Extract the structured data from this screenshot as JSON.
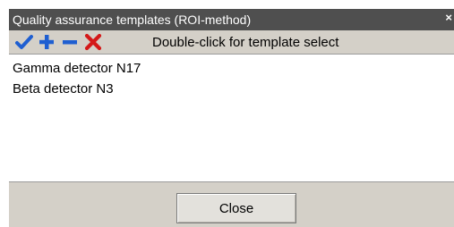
{
  "window": {
    "title": "Quality assurance templates (ROI-method)",
    "close_glyph": "×"
  },
  "toolbar": {
    "buttons": [
      {
        "icon": "checkmark-icon",
        "color": "#1f5fd1"
      },
      {
        "icon": "plus-icon",
        "color": "#1f5fd1"
      },
      {
        "icon": "minus-icon",
        "color": "#1f5fd1"
      },
      {
        "icon": "delete-x-icon",
        "color": "#d41919"
      }
    ],
    "hint": "Double-click for template select"
  },
  "templates": {
    "items": [
      "Gamma detector N17",
      "Beta detector N3"
    ]
  },
  "footer": {
    "close_label": "Close"
  }
}
